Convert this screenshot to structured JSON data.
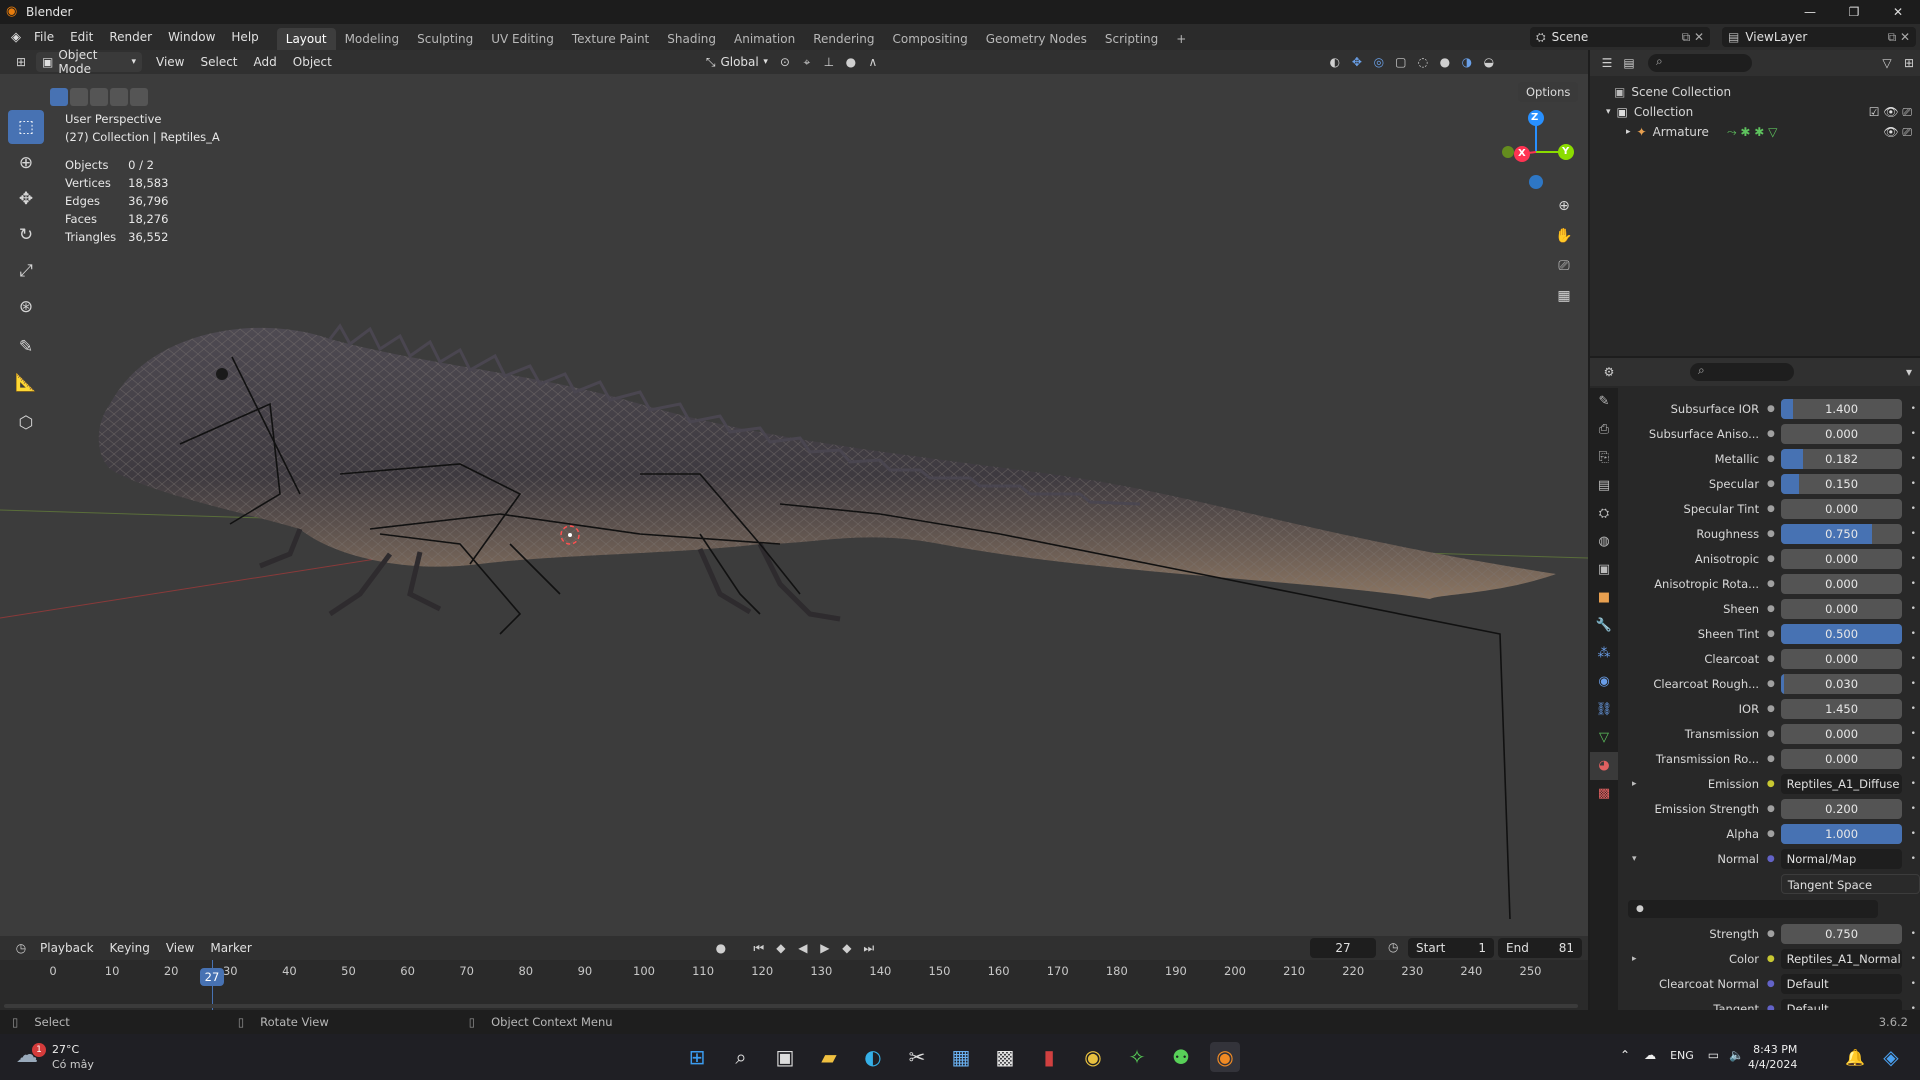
{
  "window": {
    "title": "Blender",
    "controls": [
      "—",
      "❐",
      "✕"
    ]
  },
  "menu": [
    "File",
    "Edit",
    "Render",
    "Window",
    "Help"
  ],
  "workspaces": [
    "Layout",
    "Modeling",
    "Sculpting",
    "UV Editing",
    "Texture Paint",
    "Shading",
    "Animation",
    "Rendering",
    "Compositing",
    "Geometry Nodes",
    "Scripting"
  ],
  "workspace_add": "+",
  "scene": {
    "name": "Scene",
    "view_layer": "ViewLayer"
  },
  "viewport_header": {
    "mode": "Object Mode",
    "menus": [
      "View",
      "Select",
      "Add",
      "Object"
    ],
    "orientation": "Global",
    "options": "Options"
  },
  "viewport": {
    "perspective": "User Perspective",
    "collection": "(27) Collection | Reptiles_A",
    "stats": [
      {
        "label": "Objects",
        "value": "0 / 2"
      },
      {
        "label": "Vertices",
        "value": "18,583"
      },
      {
        "label": "Edges",
        "value": "36,796"
      },
      {
        "label": "Faces",
        "value": "18,276"
      },
      {
        "label": "Triangles",
        "value": "36,552"
      }
    ],
    "gizmo": {
      "z": "Z",
      "x": "X",
      "y": "Y"
    }
  },
  "outliner": {
    "scene_collection": "Scene Collection",
    "collection": "Collection",
    "armature": "Armature"
  },
  "properties": [
    {
      "label": "Subsurface IOR",
      "value": "1.400",
      "fill": 0.1,
      "type": "slider"
    },
    {
      "label": "Subsurface Aniso...",
      "value": "0.000",
      "fill": 0,
      "type": "slider"
    },
    {
      "label": "Metallic",
      "value": "0.182",
      "fill": 0.182,
      "type": "slider"
    },
    {
      "label": "Specular",
      "value": "0.150",
      "fill": 0.15,
      "type": "slider"
    },
    {
      "label": "Specular Tint",
      "value": "0.000",
      "fill": 0,
      "type": "slider"
    },
    {
      "label": "Roughness",
      "value": "0.750",
      "fill": 0.75,
      "type": "slider"
    },
    {
      "label": "Anisotropic",
      "value": "0.000",
      "fill": 0,
      "type": "slider"
    },
    {
      "label": "Anisotropic Rota...",
      "value": "0.000",
      "fill": 0,
      "type": "slider"
    },
    {
      "label": "Sheen",
      "value": "0.000",
      "fill": 0,
      "type": "slider"
    },
    {
      "label": "Sheen Tint",
      "value": "0.500",
      "fill": 1.0,
      "type": "slider"
    },
    {
      "label": "Clearcoat",
      "value": "0.000",
      "fill": 0,
      "type": "slider"
    },
    {
      "label": "Clearcoat Rough...",
      "value": "0.030",
      "fill": 0.03,
      "type": "slider"
    },
    {
      "label": "IOR",
      "value": "1.450",
      "fill": 0,
      "type": "slider"
    },
    {
      "label": "Transmission",
      "value": "0.000",
      "fill": 0,
      "type": "slider"
    },
    {
      "label": "Transmission Ro...",
      "value": "0.000",
      "fill": 0,
      "type": "slider"
    },
    {
      "label": "Emission",
      "value": "Reptiles_A1_Diffuse",
      "type": "link",
      "dot": "#c8c832",
      "expander": "▸"
    },
    {
      "label": "Emission Strength",
      "value": "0.200",
      "fill": 0,
      "type": "slider"
    },
    {
      "label": "Alpha",
      "value": "1.000",
      "fill": 1.0,
      "type": "slider"
    },
    {
      "label": "Normal",
      "value": "Normal/Map",
      "type": "link",
      "dot": "#6363c7",
      "expander": "▾"
    },
    {
      "label": "",
      "value": "Tangent Space",
      "type": "dropdown"
    },
    {
      "label": "",
      "value": "",
      "type": "blank"
    },
    {
      "label": "Strength",
      "value": "0.750",
      "fill": 0,
      "type": "slider"
    },
    {
      "label": "Color",
      "value": "Reptiles_A1_Normal",
      "type": "link",
      "dot": "#c8c832",
      "expander": "▸"
    },
    {
      "label": "Clearcoat Normal",
      "value": "Default",
      "type": "link",
      "dot": "#6363c7"
    },
    {
      "label": "Tangent",
      "value": "Default",
      "type": "link",
      "dot": "#6363c7"
    }
  ],
  "timeline": {
    "menus": [
      "Playback",
      "Keying",
      "View",
      "Marker"
    ],
    "current_frame": "27",
    "start_label": "Start",
    "start": "1",
    "end_label": "End",
    "end": "81",
    "ticks": [
      "0",
      "10",
      "20",
      "30",
      "40",
      "50",
      "60",
      "70",
      "80",
      "90",
      "100",
      "110",
      "120",
      "130",
      "140",
      "150",
      "160",
      "170",
      "180",
      "190",
      "200",
      "210",
      "220",
      "230",
      "240",
      "250"
    ]
  },
  "statusbar": {
    "select": "Select",
    "rotate": "Rotate View",
    "context": "Object Context Menu",
    "version": "3.6.2"
  },
  "taskbar": {
    "temp": "27°C",
    "weather": "Có mây",
    "lang": "ENG",
    "time": "8:43 PM",
    "date": "4/4/2024",
    "badge": "1"
  },
  "colors": {
    "accent": "#4772b3",
    "axis_x": "#ff3352",
    "axis_y": "#8bdc00",
    "axis_z": "#2890ff",
    "header": "#303030"
  }
}
